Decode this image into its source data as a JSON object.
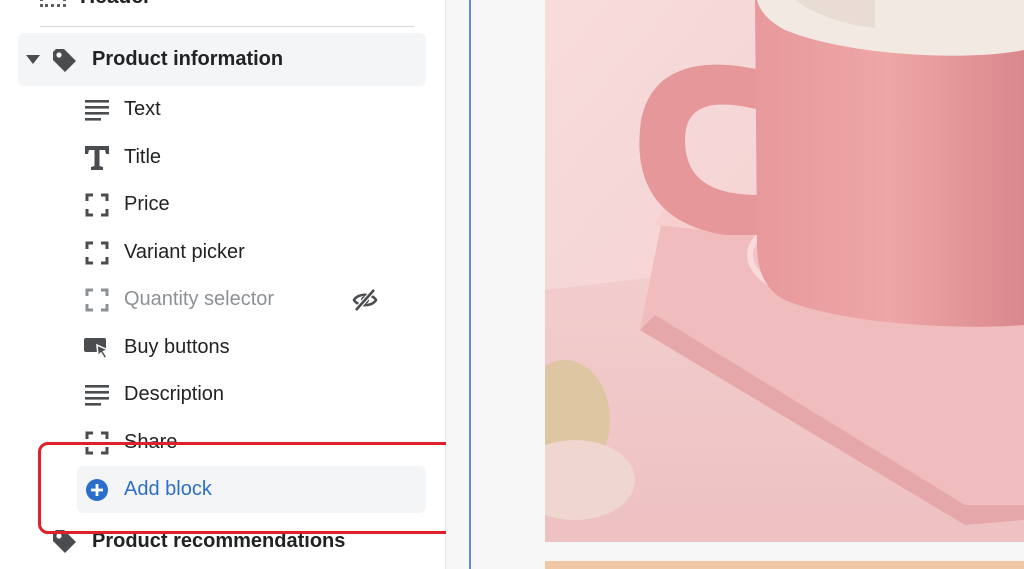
{
  "sidebar": {
    "header_item": {
      "label": "Header"
    },
    "section": {
      "title": "Product information"
    },
    "blocks": [
      {
        "label": "Text",
        "icon": "text-lines-icon"
      },
      {
        "label": "Title",
        "icon": "title-t-icon"
      },
      {
        "label": "Price",
        "icon": "dashed-frame-icon"
      },
      {
        "label": "Variant picker",
        "icon": "dashed-frame-icon"
      },
      {
        "label": "Quantity selector",
        "icon": "dashed-frame-icon",
        "hidden": true
      },
      {
        "label": "Buy buttons",
        "icon": "buy-buttons-icon"
      },
      {
        "label": "Description",
        "icon": "text-lines-icon"
      },
      {
        "label": "Share",
        "icon": "dashed-frame-icon"
      }
    ],
    "add_block": {
      "label": "Add block",
      "icon": "plus-circle-icon"
    },
    "next_section": {
      "title": "Product recommendations"
    }
  },
  "colors": {
    "accent": "#2c6ecb",
    "highlight": "#e0202b",
    "muted_text": "#8c9196",
    "mug_pink": "#e89a9c",
    "background_pink": "#f6d3d3"
  }
}
